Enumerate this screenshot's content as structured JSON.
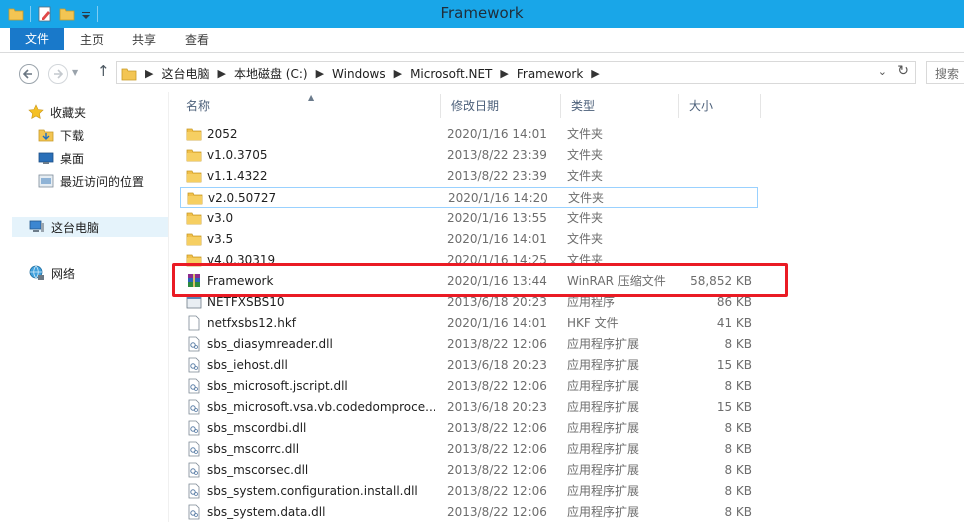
{
  "window": {
    "title": "Framework"
  },
  "ribbon": {
    "tabs": [
      "文件",
      "主页",
      "共享",
      "查看"
    ]
  },
  "address": {
    "crumbs": [
      "这台电脑",
      "本地磁盘 (C:)",
      "Windows",
      "Microsoft.NET",
      "Framework"
    ],
    "search_placeholder": "搜索"
  },
  "nav": {
    "favorites": "收藏夹",
    "downloads": "下载",
    "desktop": "桌面",
    "recent": "最近访问的位置",
    "this_pc": "这台电脑",
    "network": "网络"
  },
  "columns": {
    "name": "名称",
    "date": "修改日期",
    "type": "类型",
    "size": "大小"
  },
  "files": [
    {
      "icon": "folder-icon",
      "name": "2052",
      "date": "2020/1/16 14:01",
      "type": "文件夹",
      "size": ""
    },
    {
      "icon": "folder-icon",
      "name": "v1.0.3705",
      "date": "2013/8/22 23:39",
      "type": "文件夹",
      "size": ""
    },
    {
      "icon": "folder-icon",
      "name": "v1.1.4322",
      "date": "2013/8/22 23:39",
      "type": "文件夹",
      "size": ""
    },
    {
      "icon": "folder-icon",
      "name": "v2.0.50727",
      "date": "2020/1/16 14:20",
      "type": "文件夹",
      "size": ""
    },
    {
      "icon": "folder-icon",
      "name": "v3.0",
      "date": "2020/1/16 13:55",
      "type": "文件夹",
      "size": ""
    },
    {
      "icon": "folder-icon",
      "name": "v3.5",
      "date": "2020/1/16 14:01",
      "type": "文件夹",
      "size": ""
    },
    {
      "icon": "folder-icon",
      "name": "v4.0.30319",
      "date": "2020/1/16 14:25",
      "type": "文件夹",
      "size": ""
    },
    {
      "icon": "winrar-icon",
      "name": "Framework",
      "date": "2020/1/16 13:44",
      "type": "WinRAR 压缩文件",
      "size": "58,852 KB"
    },
    {
      "icon": "exe-icon",
      "name": "NETFXSBS10",
      "date": "2013/6/18 20:23",
      "type": "应用程序",
      "size": "86 KB"
    },
    {
      "icon": "file-icon",
      "name": "netfxsbs12.hkf",
      "date": "2020/1/16 14:01",
      "type": "HKF 文件",
      "size": "41 KB"
    },
    {
      "icon": "dll-icon",
      "name": "sbs_diasymreader.dll",
      "date": "2013/8/22 12:06",
      "type": "应用程序扩展",
      "size": "8 KB"
    },
    {
      "icon": "dll-icon",
      "name": "sbs_iehost.dll",
      "date": "2013/6/18 20:23",
      "type": "应用程序扩展",
      "size": "15 KB"
    },
    {
      "icon": "dll-icon",
      "name": "sbs_microsoft.jscript.dll",
      "date": "2013/8/22 12:06",
      "type": "应用程序扩展",
      "size": "8 KB"
    },
    {
      "icon": "dll-icon",
      "name": "sbs_microsoft.vsa.vb.codedomproce...",
      "date": "2013/6/18 20:23",
      "type": "应用程序扩展",
      "size": "15 KB"
    },
    {
      "icon": "dll-icon",
      "name": "sbs_mscordbi.dll",
      "date": "2013/8/22 12:06",
      "type": "应用程序扩展",
      "size": "8 KB"
    },
    {
      "icon": "dll-icon",
      "name": "sbs_mscorrc.dll",
      "date": "2013/8/22 12:06",
      "type": "应用程序扩展",
      "size": "8 KB"
    },
    {
      "icon": "dll-icon",
      "name": "sbs_mscorsec.dll",
      "date": "2013/8/22 12:06",
      "type": "应用程序扩展",
      "size": "8 KB"
    },
    {
      "icon": "dll-icon",
      "name": "sbs_system.configuration.install.dll",
      "date": "2013/8/22 12:06",
      "type": "应用程序扩展",
      "size": "8 KB"
    },
    {
      "icon": "dll-icon",
      "name": "sbs_system.data.dll",
      "date": "2013/8/22 12:06",
      "type": "应用程序扩展",
      "size": "8 KB"
    }
  ],
  "colors": {
    "titlebar": "#19a6e8",
    "file_tab": "#1979ca",
    "highlight_border": "#ea1b24",
    "folder": "#e8b33b"
  }
}
